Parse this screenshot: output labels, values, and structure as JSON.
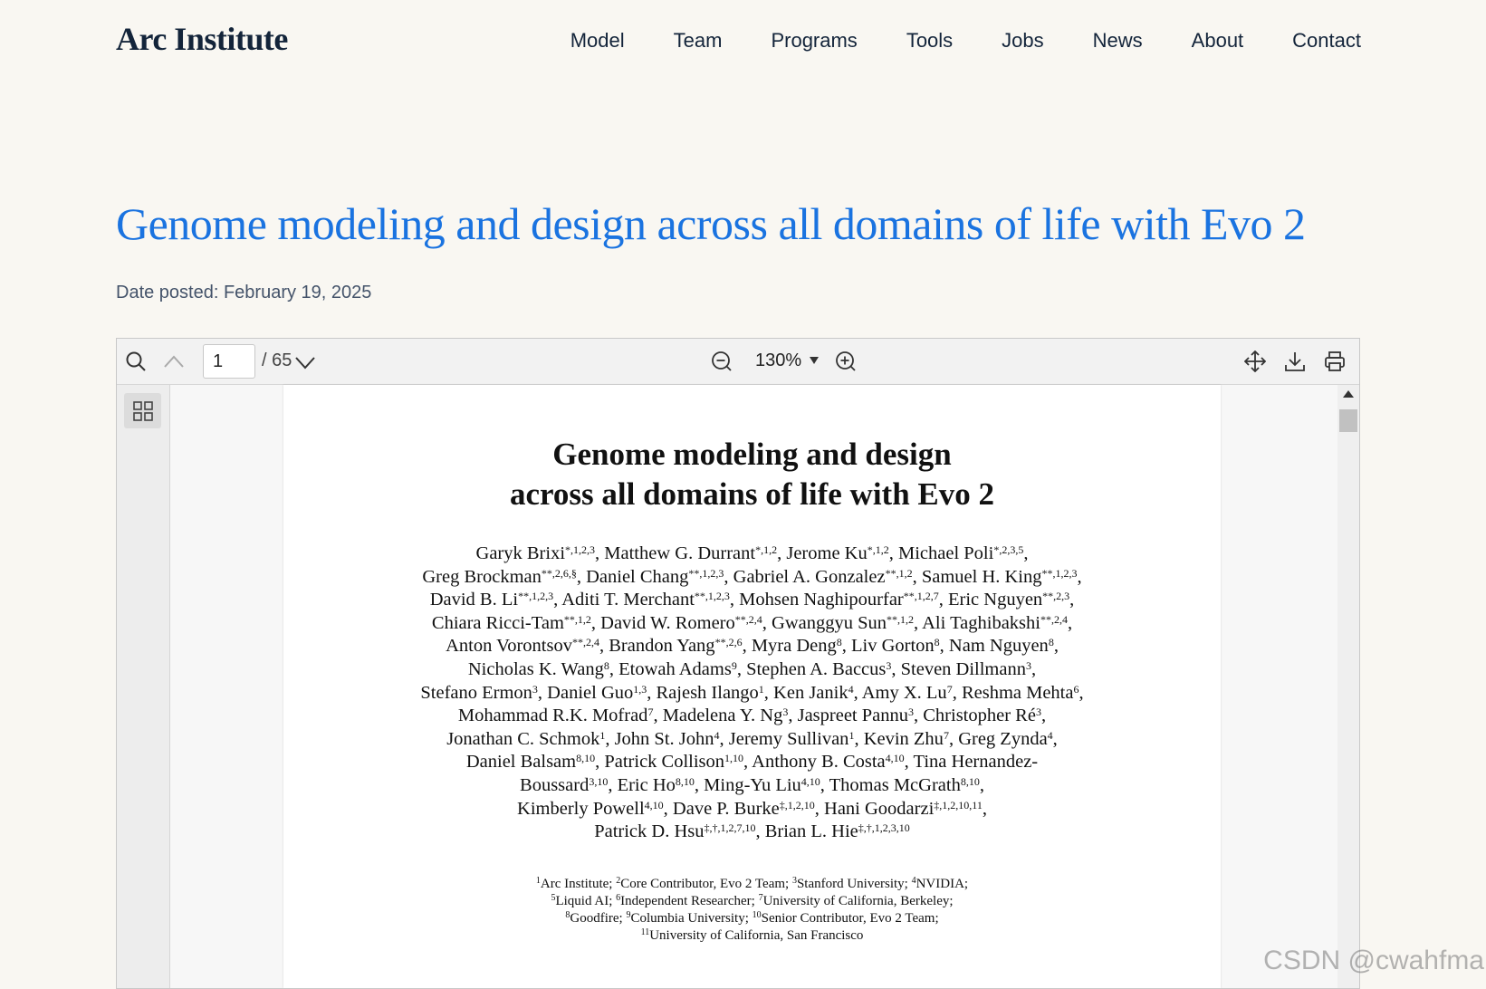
{
  "site": {
    "logo": "Arc Institute",
    "nav": [
      "Model",
      "Team",
      "Programs",
      "Tools",
      "Jobs",
      "News",
      "About",
      "Contact"
    ]
  },
  "article": {
    "title": "Genome modeling and design across all domains of life with Evo 2",
    "date_posted": "Date posted: February 19, 2025"
  },
  "viewer": {
    "current_page": "1",
    "total_pages": "/ 65",
    "zoom": "130%",
    "icons": [
      "search-icon",
      "chevron-up-icon",
      "chevron-down-icon",
      "zoom-out-icon",
      "zoom-in-icon",
      "move-icon",
      "download-icon",
      "print-icon",
      "thumbnails-icon"
    ]
  },
  "paper": {
    "title_line1": "Genome modeling and design",
    "title_line2": "across all domains of life with Evo 2",
    "authors_lines": [
      [
        [
          "Garyk Brixi",
          "*,1,2,3"
        ],
        [
          ", Matthew G. Durrant",
          "*,1,2"
        ],
        [
          ", Jerome Ku",
          "*,1,2"
        ],
        [
          ", Michael Poli",
          "*,2,3,5"
        ],
        [
          ",",
          ""
        ]
      ],
      [
        [
          "Greg Brockman",
          "**,2,6,§"
        ],
        [
          ", Daniel Chang",
          "**,1,2,3"
        ],
        [
          ", Gabriel A. Gonzalez",
          "**,1,2"
        ],
        [
          ", Samuel H. King",
          "**,1,2,3"
        ],
        [
          ",",
          ""
        ]
      ],
      [
        [
          "David B. Li",
          "**,1,2,3"
        ],
        [
          ", Aditi T. Merchant",
          "**,1,2,3"
        ],
        [
          ", Mohsen Naghipourfar",
          "**,1,2,7"
        ],
        [
          ", Eric Nguyen",
          "**,2,3"
        ],
        [
          ",",
          ""
        ]
      ],
      [
        [
          "Chiara Ricci-Tam",
          "**,1,2"
        ],
        [
          ", David W. Romero",
          "**,2,4"
        ],
        [
          ", Gwanggyu Sun",
          "**,1,2"
        ],
        [
          ", Ali Taghibakshi",
          "**,2,4"
        ],
        [
          ",",
          ""
        ]
      ],
      [
        [
          "Anton Vorontsov",
          "**,2,4"
        ],
        [
          ", Brandon Yang",
          "**,2,6"
        ],
        [
          ", Myra Deng",
          "8"
        ],
        [
          ", Liv Gorton",
          "8"
        ],
        [
          ", Nam Nguyen",
          "8"
        ],
        [
          ",",
          ""
        ]
      ],
      [
        [
          "Nicholas K. Wang",
          "8"
        ],
        [
          ", Etowah Adams",
          "9"
        ],
        [
          ", Stephen A. Baccus",
          "3"
        ],
        [
          ", Steven Dillmann",
          "3"
        ],
        [
          ",",
          ""
        ]
      ],
      [
        [
          "Stefano Ermon",
          "3"
        ],
        [
          ", Daniel Guo",
          "1,3"
        ],
        [
          ", Rajesh Ilango",
          "1"
        ],
        [
          ", Ken Janik",
          "4"
        ],
        [
          ", Amy X. Lu",
          "7"
        ],
        [
          ", Reshma Mehta",
          "6"
        ],
        [
          ",",
          ""
        ]
      ],
      [
        [
          "Mohammad R.K. Mofrad",
          "7"
        ],
        [
          ", Madelena Y. Ng",
          "3"
        ],
        [
          ", Jaspreet Pannu",
          "3"
        ],
        [
          ", Christopher Ré",
          "3"
        ],
        [
          ",",
          ""
        ]
      ],
      [
        [
          "Jonathan C. Schmok",
          "1"
        ],
        [
          ", John St. John",
          "4"
        ],
        [
          ", Jeremy Sullivan",
          "1"
        ],
        [
          ", Kevin Zhu",
          "7"
        ],
        [
          ", Greg Zynda",
          "4"
        ],
        [
          ",",
          ""
        ]
      ],
      [
        [
          "Daniel Balsam",
          "8,10"
        ],
        [
          ", Patrick Collison",
          "1,10"
        ],
        [
          ", Anthony B. Costa",
          "4,10"
        ],
        [
          ", Tina Hernandez-",
          ""
        ]
      ],
      [
        [
          "Boussard",
          "3,10"
        ],
        [
          ", Eric Ho",
          "8,10"
        ],
        [
          ", Ming-Yu Liu",
          "4,10"
        ],
        [
          ", Thomas McGrath",
          "8,10"
        ],
        [
          ",",
          ""
        ]
      ],
      [
        [
          "Kimberly Powell",
          "4,10"
        ],
        [
          ", Dave P. Burke",
          "‡,1,2,10"
        ],
        [
          ", Hani Goodarzi",
          "‡,1,2,10,11"
        ],
        [
          ",",
          ""
        ]
      ],
      [
        [
          "Patrick D. Hsu",
          "‡,†,1,2,7,10"
        ],
        [
          ", Brian L. Hie",
          "‡,†,1,2,3,10"
        ]
      ]
    ],
    "affiliation_lines": [
      [
        [
          "1",
          "Arc Institute; "
        ],
        [
          "2",
          "Core Contributor, Evo 2 Team; "
        ],
        [
          "3",
          "Stanford University; "
        ],
        [
          "4",
          "NVIDIA;"
        ]
      ],
      [
        [
          "5",
          "Liquid AI; "
        ],
        [
          "6",
          "Independent Researcher; "
        ],
        [
          "7",
          "University of California, Berkeley;"
        ]
      ],
      [
        [
          "8",
          "Goodfire; "
        ],
        [
          "9",
          "Columbia University; "
        ],
        [
          "10",
          "Senior Contributor, Evo 2 Team;"
        ]
      ],
      [
        [
          "11",
          "University of California, San Francisco"
        ]
      ]
    ]
  },
  "watermark": "CSDN @cwahfma"
}
